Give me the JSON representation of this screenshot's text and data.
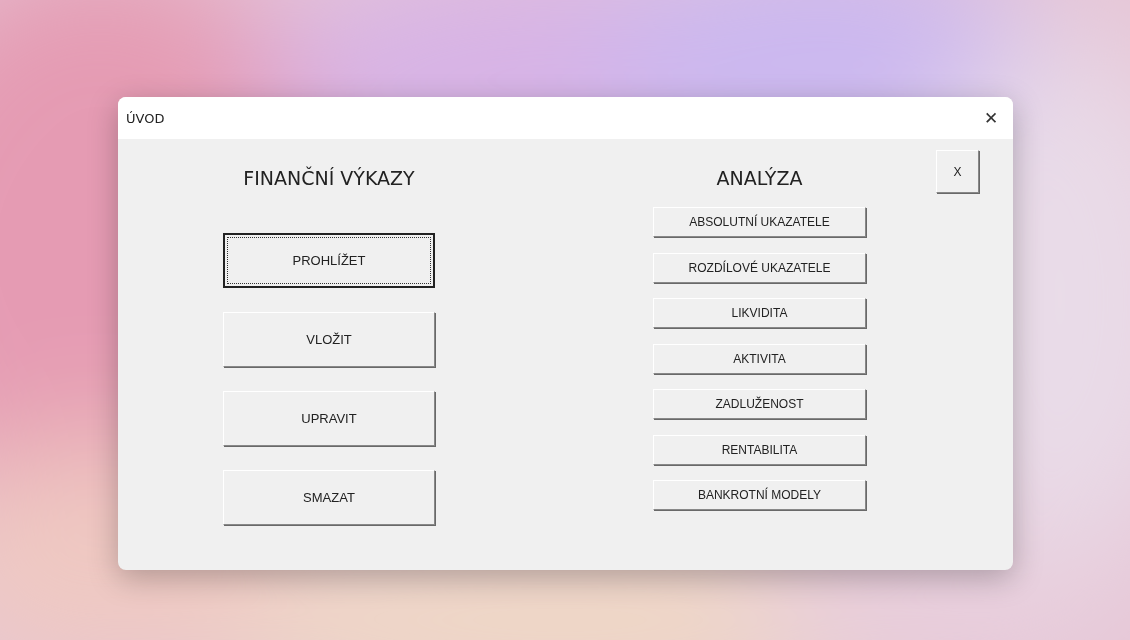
{
  "window": {
    "title": "ÚVOD",
    "close": "✕"
  },
  "left": {
    "heading": "FINANČNÍ VÝKAZY",
    "buttons": [
      {
        "label": "PROHLÍŽET",
        "focused": true
      },
      {
        "label": "VLOŽIT",
        "focused": false
      },
      {
        "label": "UPRAVIT",
        "focused": false
      },
      {
        "label": "SMAZAT",
        "focused": false
      }
    ]
  },
  "right": {
    "heading": "ANALÝZA",
    "buttons": [
      {
        "label": "ABSOLUTNÍ UKAZATELE"
      },
      {
        "label": "ROZDÍLOVÉ UKAZATELE"
      },
      {
        "label": "LIKVIDITA"
      },
      {
        "label": "AKTIVITA"
      },
      {
        "label": "ZADLUŽENOST"
      },
      {
        "label": "RENTABILITA"
      },
      {
        "label": "BANKROTNÍ MODELY"
      }
    ]
  },
  "exit_button": {
    "label": "X"
  }
}
